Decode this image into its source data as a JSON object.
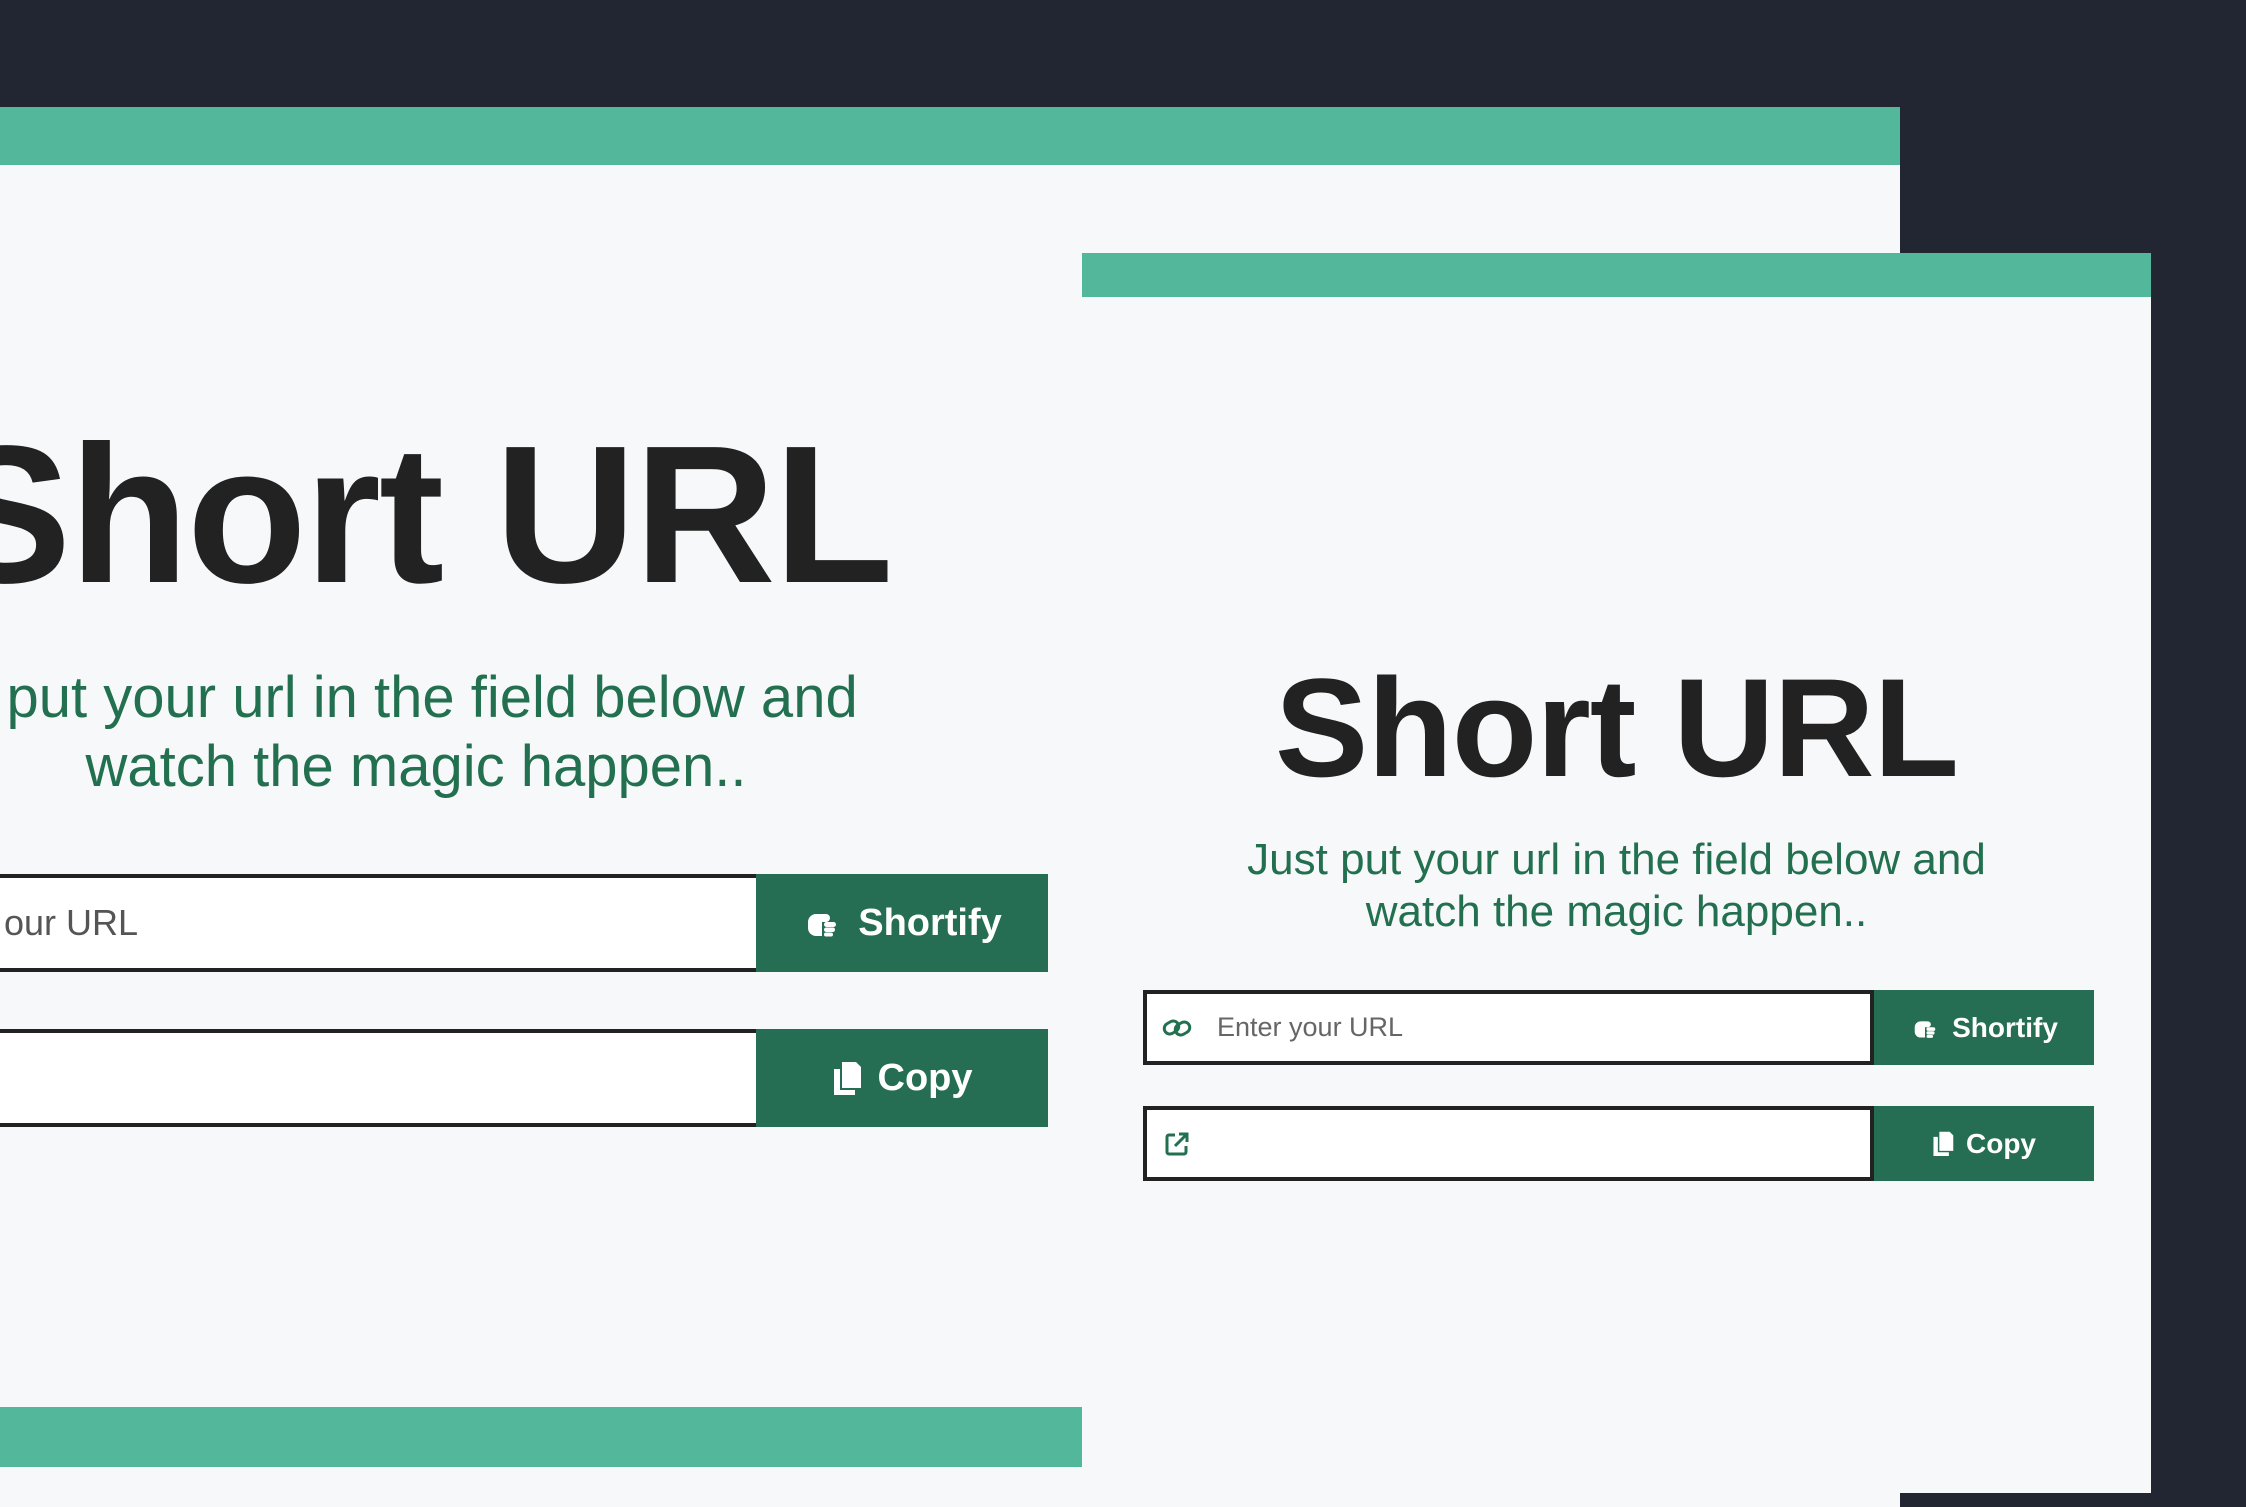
{
  "colors": {
    "background": "#222632",
    "page": "#f7f8fa",
    "accent_bar": "#53b89b",
    "button": "#256e53",
    "subtitle": "#22704f",
    "title": "#222222"
  },
  "back_window": {
    "title": "Short URL",
    "subtitle_line1": "t put your url in the field below and",
    "subtitle_line2": "watch the magic happen..",
    "url_input": {
      "placeholder": "our URL",
      "value": ""
    },
    "shortify_button": {
      "label": "Shortify",
      "icon": "pointing-hand-icon"
    },
    "result_input": {
      "value": ""
    },
    "copy_button": {
      "label": "Copy",
      "icon": "copy-icon"
    }
  },
  "front_window": {
    "title": "Short URL",
    "subtitle_line1": "Just put your url in the field below and",
    "subtitle_line2": "watch the magic happen..",
    "url_input": {
      "placeholder": "Enter your URL",
      "value": "",
      "icon": "link-icon"
    },
    "shortify_button": {
      "label": "Shortify",
      "icon": "pointing-hand-icon"
    },
    "result_input": {
      "value": "",
      "icon": "external-link-icon"
    },
    "copy_button": {
      "label": "Copy",
      "icon": "copy-icon"
    }
  }
}
